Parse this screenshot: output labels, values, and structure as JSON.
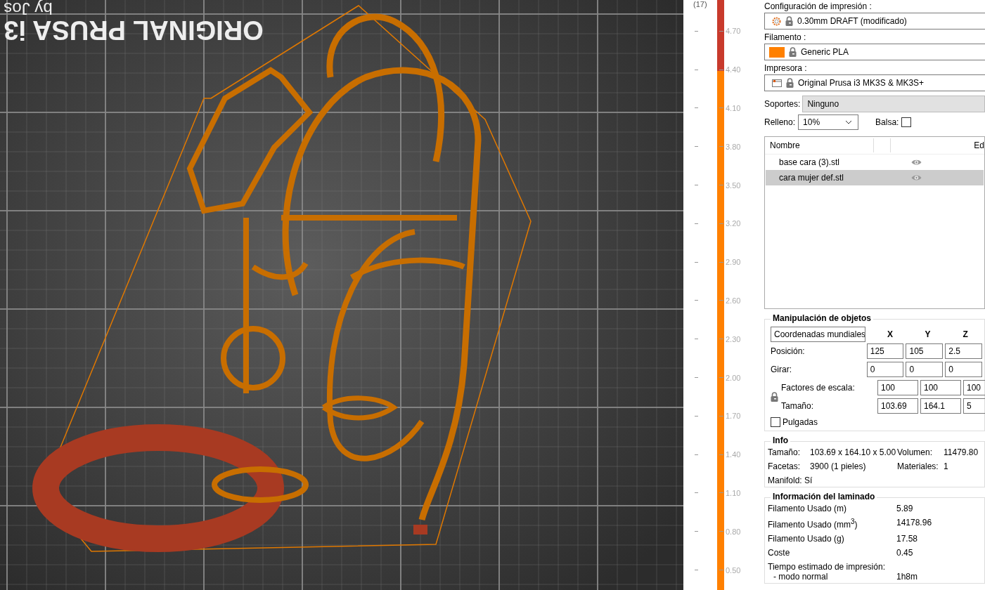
{
  "viewport": {
    "bed_label": "ORIGINAL PRUSA i3",
    "bed_sublabel": "by Jos"
  },
  "layer_slider": {
    "top_label": "(17)",
    "level": 0.88,
    "ticks": [
      "4.70",
      "4.40",
      "4.10",
      "3.80",
      "3.50",
      "3.20",
      "2.90",
      "2.60",
      "2.30",
      "2.00",
      "1.70",
      "1.40",
      "1.10",
      "0.80",
      "0.50"
    ]
  },
  "sidebar": {
    "print_settings": {
      "label": "Configuración de impresión :",
      "value": "0.30mm DRAFT (modificado)"
    },
    "filament": {
      "label": "Filamento :",
      "value": "Generic PLA",
      "color": "#ff8000"
    },
    "printer": {
      "label": "Impresora :",
      "value": "Original Prusa i3 MK3S & MK3S+"
    },
    "supports": {
      "label": "Soportes:",
      "value": "Ninguno"
    },
    "infill": {
      "label": "Relleno:",
      "value": "10%"
    },
    "brim": {
      "label": "Balsa:",
      "checked": false
    },
    "object_list": {
      "columns": [
        "Nombre",
        "Ed"
      ],
      "rows": [
        {
          "name": "base cara (3).stl",
          "selected": false
        },
        {
          "name": "cara mujer def.stl",
          "selected": true
        }
      ]
    },
    "manipulation": {
      "title": "Manipulación de objetos",
      "coord_system": "Coordenadas mundiales",
      "axes": [
        "X",
        "Y",
        "Z"
      ],
      "rows": [
        {
          "label": "Posición:",
          "values": [
            "125",
            "105",
            "2.5"
          ]
        },
        {
          "label": "Girar:",
          "values": [
            "0",
            "0",
            "0"
          ]
        }
      ],
      "scale_group": [
        {
          "label": "Factores de escala:",
          "values": [
            "100",
            "100",
            "100"
          ]
        },
        {
          "label": "Tamaño:",
          "values": [
            "103.69",
            "164.1",
            "5"
          ]
        }
      ],
      "inches": {
        "label": "Pulgadas",
        "checked": false
      }
    },
    "info": {
      "title": "Info",
      "items": [
        {
          "label": "Tamaño:",
          "value": "103.69 x 164.10 x 5.00"
        },
        {
          "label": "Volumen:",
          "value": "11479.80"
        },
        {
          "label": "Facetas:",
          "value": "3900 (1 pieles)"
        },
        {
          "label": "Materiales:",
          "value": "1"
        }
      ],
      "manifold": "Manifold: Sí"
    },
    "slice_info": {
      "title": "Información del laminado",
      "rows": [
        {
          "label": "Filamento Usado (m)",
          "value": "5.89"
        },
        {
          "label": "Filamento Usado (mm$^{3}$)",
          "value": "14178.96"
        },
        {
          "label": "Filamento Usado (g)",
          "value": "17.58"
        },
        {
          "label": "Coste",
          "value": "0.45"
        }
      ],
      "time_label": "Tiempo estimado de impresión:",
      "modes": [
        {
          "label": "- modo normal",
          "value": "1h8m"
        }
      ]
    }
  }
}
